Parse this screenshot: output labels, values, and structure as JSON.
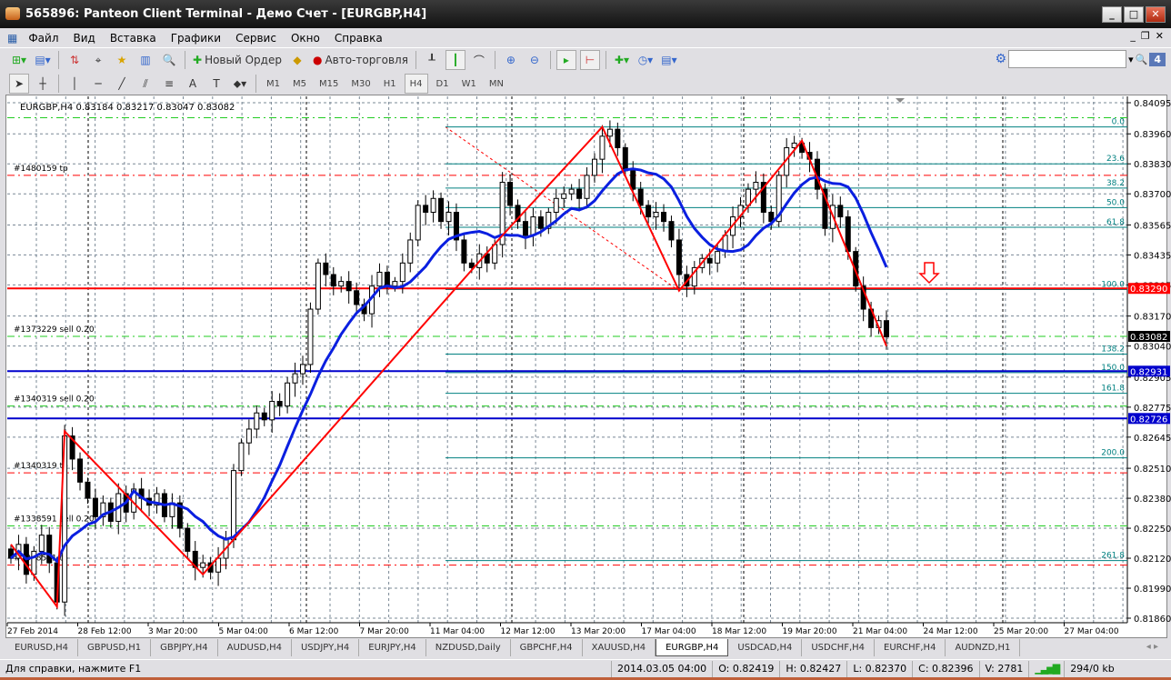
{
  "window": {
    "title": "565896: Panteon Client Terminal - Демо Счет - [EURGBP,H4]"
  },
  "menu": [
    "Файл",
    "Вид",
    "Вставка",
    "Графики",
    "Сервис",
    "Окно",
    "Справка"
  ],
  "toolbar": {
    "new_order": "Новый Ордер",
    "auto_trading": "Авто-торговля",
    "search_placeholder": "",
    "notifications": "4"
  },
  "timeframes": [
    "M1",
    "M5",
    "M15",
    "M30",
    "H1",
    "H4",
    "D1",
    "W1",
    "MN"
  ],
  "active_timeframe": "H4",
  "chart": {
    "header": "EURGBP,H4  0.83184 0.83217 0.83047 0.83082",
    "price_ticks": [
      "0.84095",
      "0.83960",
      "0.83830",
      "0.83700",
      "0.83565",
      "0.83435",
      "0.83305",
      "0.83170",
      "0.83040",
      "0.82905",
      "0.82775",
      "0.82645",
      "0.82510",
      "0.82380",
      "0.82250",
      "0.82120",
      "0.81990",
      "0.81860"
    ],
    "date_ticks": [
      "27 Feb 2014",
      "28 Feb 12:00",
      "3 Mar 20:00",
      "5 Mar 04:00",
      "6 Mar 12:00",
      "7 Mar 20:00",
      "11 Mar 04:00",
      "12 Mar 12:00",
      "13 Mar 20:00",
      "17 Mar 04:00",
      "18 Mar 12:00",
      "19 Mar 20:00",
      "21 Mar 04:00",
      "24 Mar 12:00",
      "25 Mar 20:00",
      "27 Mar 04:00"
    ],
    "bid_label": "0.83082",
    "colors": {
      "bull": "#ffffff",
      "bear": "#000000",
      "ma": "#0a1fe0",
      "zigzag": "#ff0000",
      "fibo": "#008080",
      "grid": "#7a8896"
    },
    "closes": [
      0.8212,
      0.8218,
      0.8205,
      0.8215,
      0.8222,
      0.821,
      0.8193,
      0.8265,
      0.8255,
      0.8245,
      0.8238,
      0.823,
      0.8236,
      0.8228,
      0.824,
      0.8232,
      0.8242,
      0.8238,
      0.8235,
      0.824,
      0.823,
      0.8236,
      0.8225,
      0.8215,
      0.8208,
      0.821,
      0.8206,
      0.8212,
      0.822,
      0.825,
      0.8262,
      0.8268,
      0.8275,
      0.8272,
      0.828,
      0.8278,
      0.8288,
      0.8292,
      0.8296,
      0.832,
      0.834,
      0.8335,
      0.833,
      0.8332,
      0.8328,
      0.8322,
      0.8318,
      0.833,
      0.8336,
      0.833,
      0.8332,
      0.834,
      0.835,
      0.8365,
      0.8362,
      0.8368,
      0.8358,
      0.8362,
      0.835,
      0.834,
      0.8338,
      0.8344,
      0.834,
      0.8348,
      0.8375,
      0.8365,
      0.8358,
      0.8352,
      0.836,
      0.8355,
      0.8362,
      0.8368,
      0.837,
      0.8372,
      0.8368,
      0.8378,
      0.8385,
      0.8395,
      0.8398,
      0.839,
      0.838,
      0.8372,
      0.8365,
      0.836,
      0.8362,
      0.8358,
      0.835,
      0.8335,
      0.833,
      0.8338,
      0.8342,
      0.834,
      0.8345,
      0.8352,
      0.836,
      0.8365,
      0.8372,
      0.8375,
      0.8362,
      0.8358,
      0.8378,
      0.839,
      0.8392,
      0.8388,
      0.8385,
      0.8372,
      0.8355,
      0.8365,
      0.836,
      0.8345,
      0.833,
      0.832,
      0.8312,
      0.8315,
      0.8308
    ],
    "wick": 0.0004,
    "ma_period": 10,
    "zigzag": [
      [
        0,
        0.8218
      ],
      [
        6,
        0.8191
      ],
      [
        7,
        0.8267
      ],
      [
        25,
        0.8205
      ],
      [
        64,
        0.8352
      ],
      [
        77,
        0.8399
      ],
      [
        87,
        0.8328
      ],
      [
        103,
        0.8393
      ],
      [
        114,
        0.8304
      ]
    ],
    "hlines": [
      {
        "price": 0.8329,
        "color": "#ff0000",
        "label": "0.83290",
        "style": "solid",
        "w": 2
      },
      {
        "price": 0.82931,
        "color": "#0000cc",
        "label": "0.82931",
        "style": "solid",
        "w": 2
      },
      {
        "price": 0.82726,
        "color": "#0000cc",
        "label": "0.82726",
        "style": "solid",
        "w": 2
      }
    ],
    "orders": [
      {
        "price": 0.8403,
        "color": "#22cc22",
        "text": ""
      },
      {
        "price": 0.8378,
        "color": "#ff0000",
        "text": "#1480159 tp"
      },
      {
        "price": 0.83082,
        "color": "#22cc22",
        "text": "#1373229 sell 0.20"
      },
      {
        "price": 0.8278,
        "color": "#22cc22",
        "text": "#1340319 sell 0.20"
      },
      {
        "price": 0.8249,
        "color": "#ff0000",
        "text": "#1340319 tp"
      },
      {
        "price": 0.8226,
        "color": "#22cc22",
        "text": "#1338591 sell 0.20"
      },
      {
        "price": 0.8209,
        "color": "#ff0000",
        "text": "#1338591 tp"
      }
    ],
    "fibo": [
      [
        "0.0",
        0.8399
      ],
      [
        "23.6",
        0.8383
      ],
      [
        "38.2",
        0.83725
      ],
      [
        "50.0",
        0.8364
      ],
      [
        "61.8",
        0.83555
      ],
      [
        "100.0",
        0.83285
      ],
      [
        "138.2",
        0.83005
      ],
      [
        "150.0",
        0.82925
      ],
      [
        "161.8",
        0.82835
      ],
      [
        "200.0",
        0.82555
      ],
      [
        "261.8",
        0.8211
      ]
    ]
  },
  "tabs": [
    "EURUSD,H4",
    "GBPUSD,H1",
    "GBPJPY,H4",
    "AUDUSD,H4",
    "USDJPY,H4",
    "EURJPY,H4",
    "NZDUSD,Daily",
    "GBPCHF,H4",
    "XAUUSD,H4",
    "EURGBP,H4",
    "USDCAD,H4",
    "USDCHF,H4",
    "EURCHF,H4",
    "AUDNZD,H1"
  ],
  "active_tab": "EURGBP,H4",
  "status": {
    "help": "Для справки, нажмите F1",
    "datetime": "2014.03.05 04:00",
    "open": "O: 0.82419",
    "high": "H: 0.82427",
    "low": "L: 0.82370",
    "close": "C: 0.82396",
    "volume": "V: 2781",
    "traffic": "294/0 kb"
  }
}
